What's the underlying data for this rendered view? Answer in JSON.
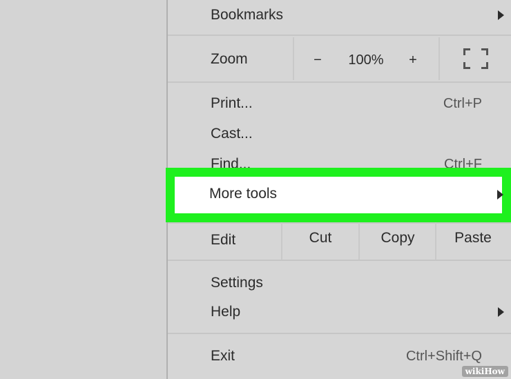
{
  "menu": {
    "bookmarks": {
      "label": "Bookmarks"
    },
    "zoom": {
      "label": "Zoom",
      "minus": "−",
      "value": "100%",
      "plus": "+"
    },
    "print": {
      "label": "Print...",
      "shortcut": "Ctrl+P"
    },
    "cast": {
      "label": "Cast..."
    },
    "find": {
      "label": "Find...",
      "shortcut": "Ctrl+F"
    },
    "more_tools": {
      "label": "More tools"
    },
    "edit": {
      "label": "Edit",
      "cut": "Cut",
      "copy": "Copy",
      "paste": "Paste"
    },
    "settings": {
      "label": "Settings"
    },
    "help": {
      "label": "Help"
    },
    "exit": {
      "label": "Exit",
      "shortcut": "Ctrl+Shift+Q"
    }
  },
  "watermark": {
    "text": "wikiHow"
  },
  "colors": {
    "highlight": "#1ef01e",
    "menu_bg": "#d6d6d6",
    "page_bg": "#d4d4d4"
  }
}
